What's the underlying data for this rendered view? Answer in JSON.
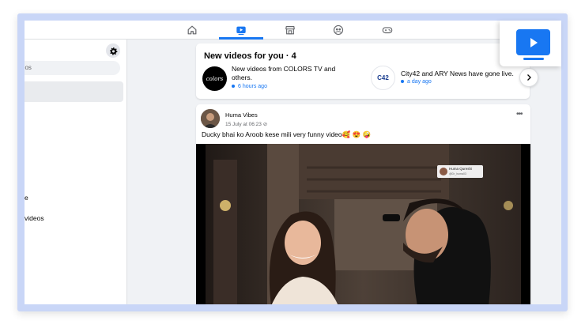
{
  "nav": {
    "icons": [
      "home-icon",
      "watch-icon",
      "marketplace-icon",
      "groups-icon",
      "gaming-icon"
    ],
    "active_index": 1
  },
  "sidebar": {
    "search_placeholder": "eos",
    "items": [
      {
        "label": "e"
      },
      {
        "label": "videos"
      }
    ]
  },
  "new_videos": {
    "title": "New videos for you · 4",
    "items": [
      {
        "text": "New videos from COLORS TV and others.",
        "time": "6 hours ago",
        "logo": "colors"
      },
      {
        "text": "City42 and ARY News have gone live.",
        "time": "a day ago",
        "logo": "C42"
      }
    ]
  },
  "post": {
    "author": "Huma Vibes",
    "date": "15 July at 06:23",
    "caption": "Ducky bhai ko Aroob kese mili very funny video🥰 😍 🤪",
    "video_tag_name": "Huma Qureshi",
    "video_tag_handle": "@Dr_huma03"
  },
  "colors": {
    "accent": "#1877f2",
    "frame": "#c9d6f7",
    "background": "#f0f2f5"
  }
}
